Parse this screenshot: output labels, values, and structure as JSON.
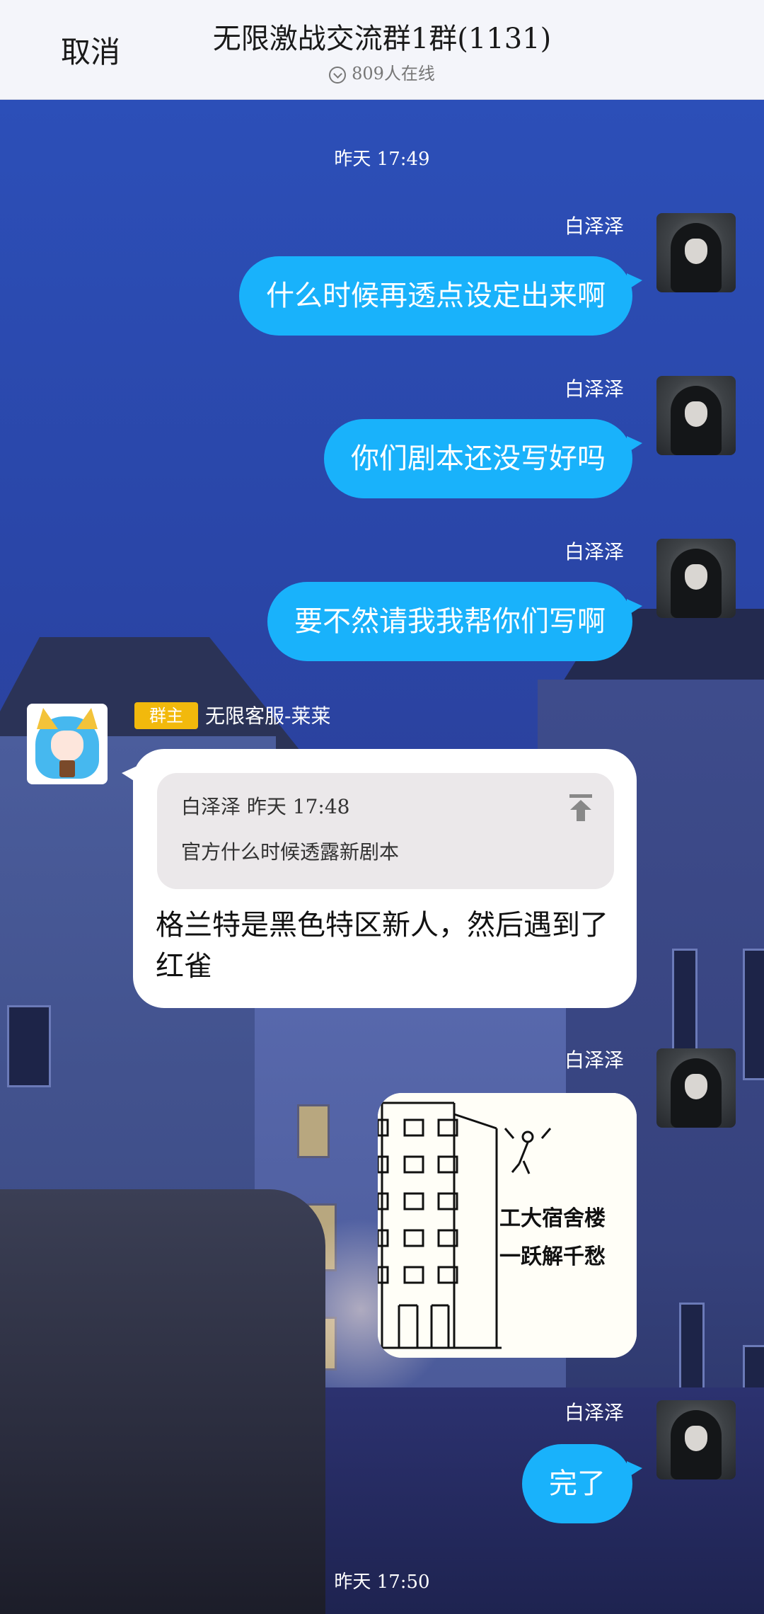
{
  "header": {
    "cancel_label": "取消",
    "title": "无限激战交流群1群(1131)",
    "online_text": "809人在线"
  },
  "messages": {
    "time_top": "昨天 17:49",
    "time_bottom": "昨天 17:50",
    "msg1": {
      "sender": "白泽泽",
      "text": "什么时候再透点设定出来啊"
    },
    "msg2": {
      "sender": "白泽泽",
      "text": "你们剧本还没写好吗"
    },
    "msg3": {
      "sender": "白泽泽",
      "text": "要不然请我我帮你们写啊"
    },
    "admin": {
      "badge": "群主",
      "sender": "无限客服-莱莱",
      "quote_header": "白泽泽 昨天 17:48",
      "quote_text": "官方什么时候透露新剧本",
      "text": "格兰特是黑色特区新人，然后遇到了红雀"
    },
    "msg4": {
      "sender": "白泽泽",
      "image_line1": "工大宿舍楼",
      "image_line2": "一跃解千愁"
    },
    "msg5": {
      "sender": "白泽泽",
      "text": "完了"
    }
  },
  "colors": {
    "bubble_blue": "#19b2fb",
    "badge_gold": "#f2b90c",
    "header_bg": "#f4f5fa"
  }
}
